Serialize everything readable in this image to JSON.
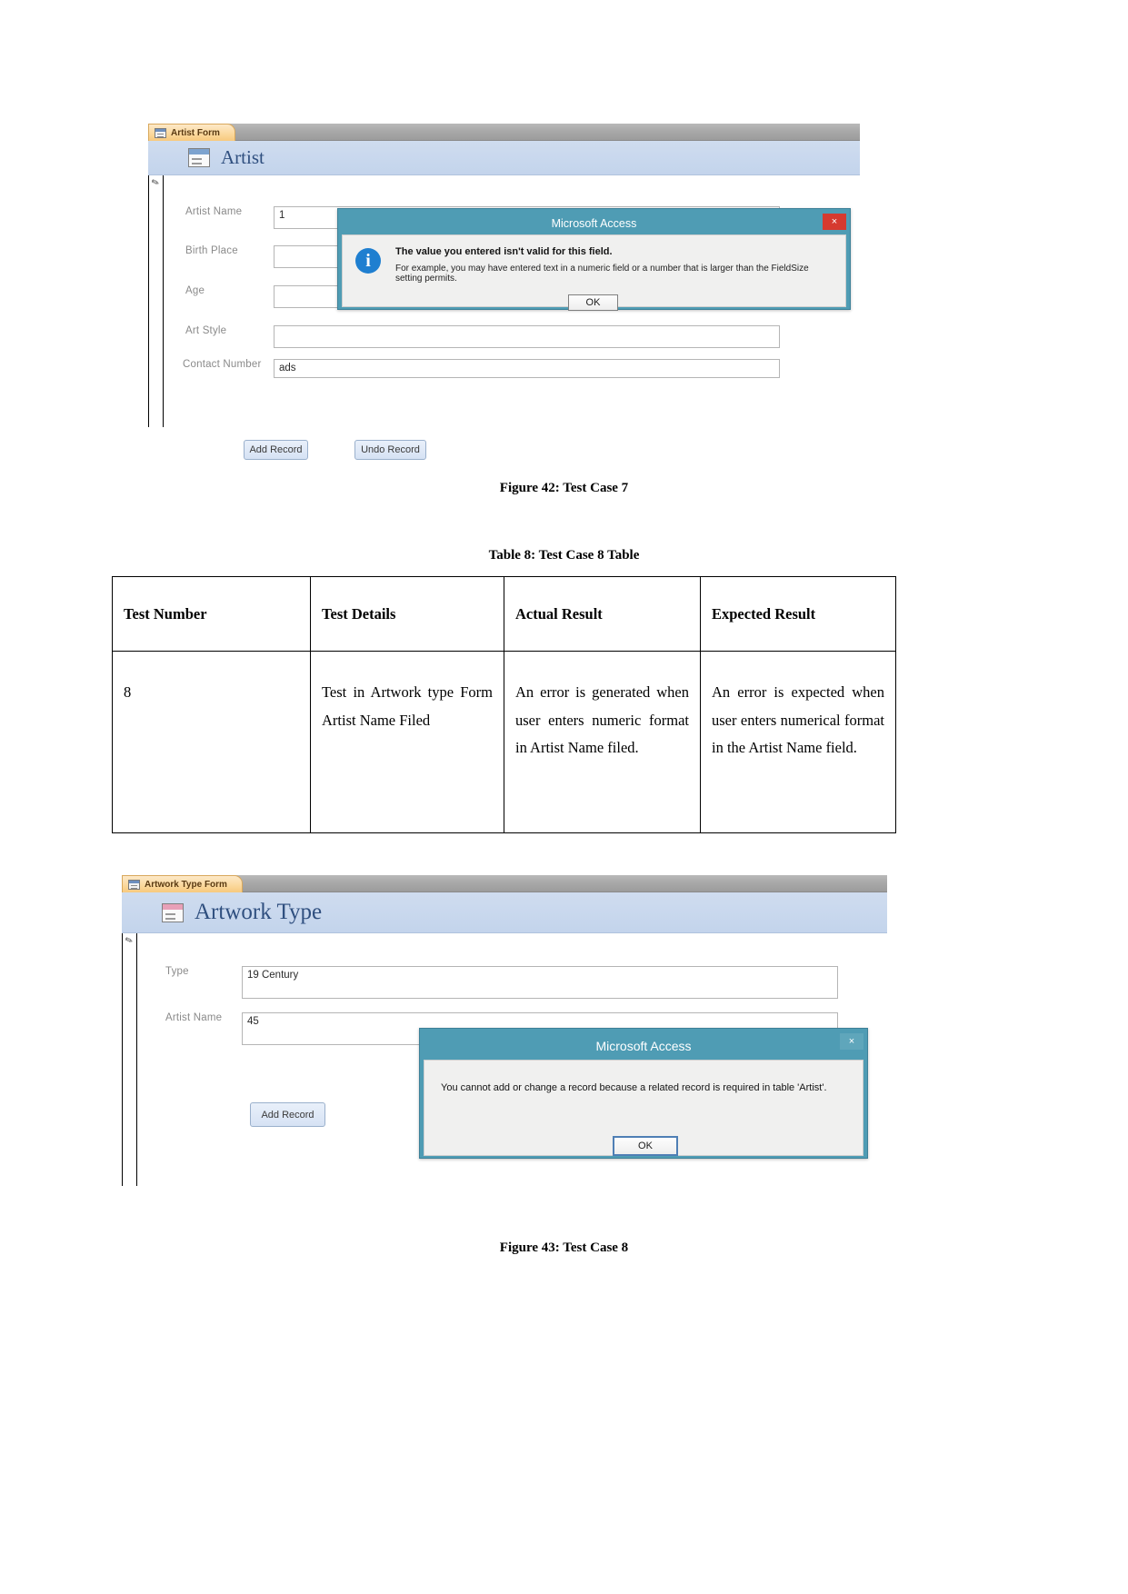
{
  "figure42": {
    "tab_label": "Artist Form",
    "form_title": "Artist",
    "fields": [
      {
        "label": "Artist Name",
        "value": "1"
      },
      {
        "label": "Birth Place",
        "value": ""
      },
      {
        "label": "Age",
        "value": ""
      },
      {
        "label": "Art Style",
        "value": ""
      },
      {
        "label": "Contact Number",
        "value": "ads"
      }
    ],
    "buttons": {
      "add_record": "Add Record",
      "undo_record": "Undo Record"
    },
    "dialog": {
      "title": "Microsoft Access",
      "close_glyph": "×",
      "heading": "The value you entered isn't valid for this field.",
      "detail": "For example, you may have entered text in a numeric field or a number that is larger than the FieldSize setting permits.",
      "ok_label": "OK"
    },
    "caption": "Figure 42: Test Case 7"
  },
  "table8": {
    "caption": "Table 8: Test Case 8 Table",
    "headers": [
      "Test Number",
      "Test Details",
      "Actual Result",
      "Expected Result"
    ],
    "rows": [
      [
        "8",
        "Test in Artwork type Form Artist Name Filed",
        "An error is generated when user enters numeric format in Artist Name filed.",
        "An error is expected when user enters numerical format in the Artist Name field."
      ]
    ]
  },
  "figure43": {
    "tab_label": "Artwork Type Form",
    "form_title": "Artwork Type",
    "fields": [
      {
        "label": "Type",
        "value": "19 Century"
      },
      {
        "label": "Artist Name",
        "value": "45"
      }
    ],
    "buttons": {
      "add_record": "Add Record"
    },
    "dialog": {
      "title": "Microsoft Access",
      "close_glyph": "×",
      "message": "You cannot add or change a record because a related record is required in table 'Artist'.",
      "ok_label": "OK"
    },
    "caption": "Figure 43: Test Case 8"
  }
}
